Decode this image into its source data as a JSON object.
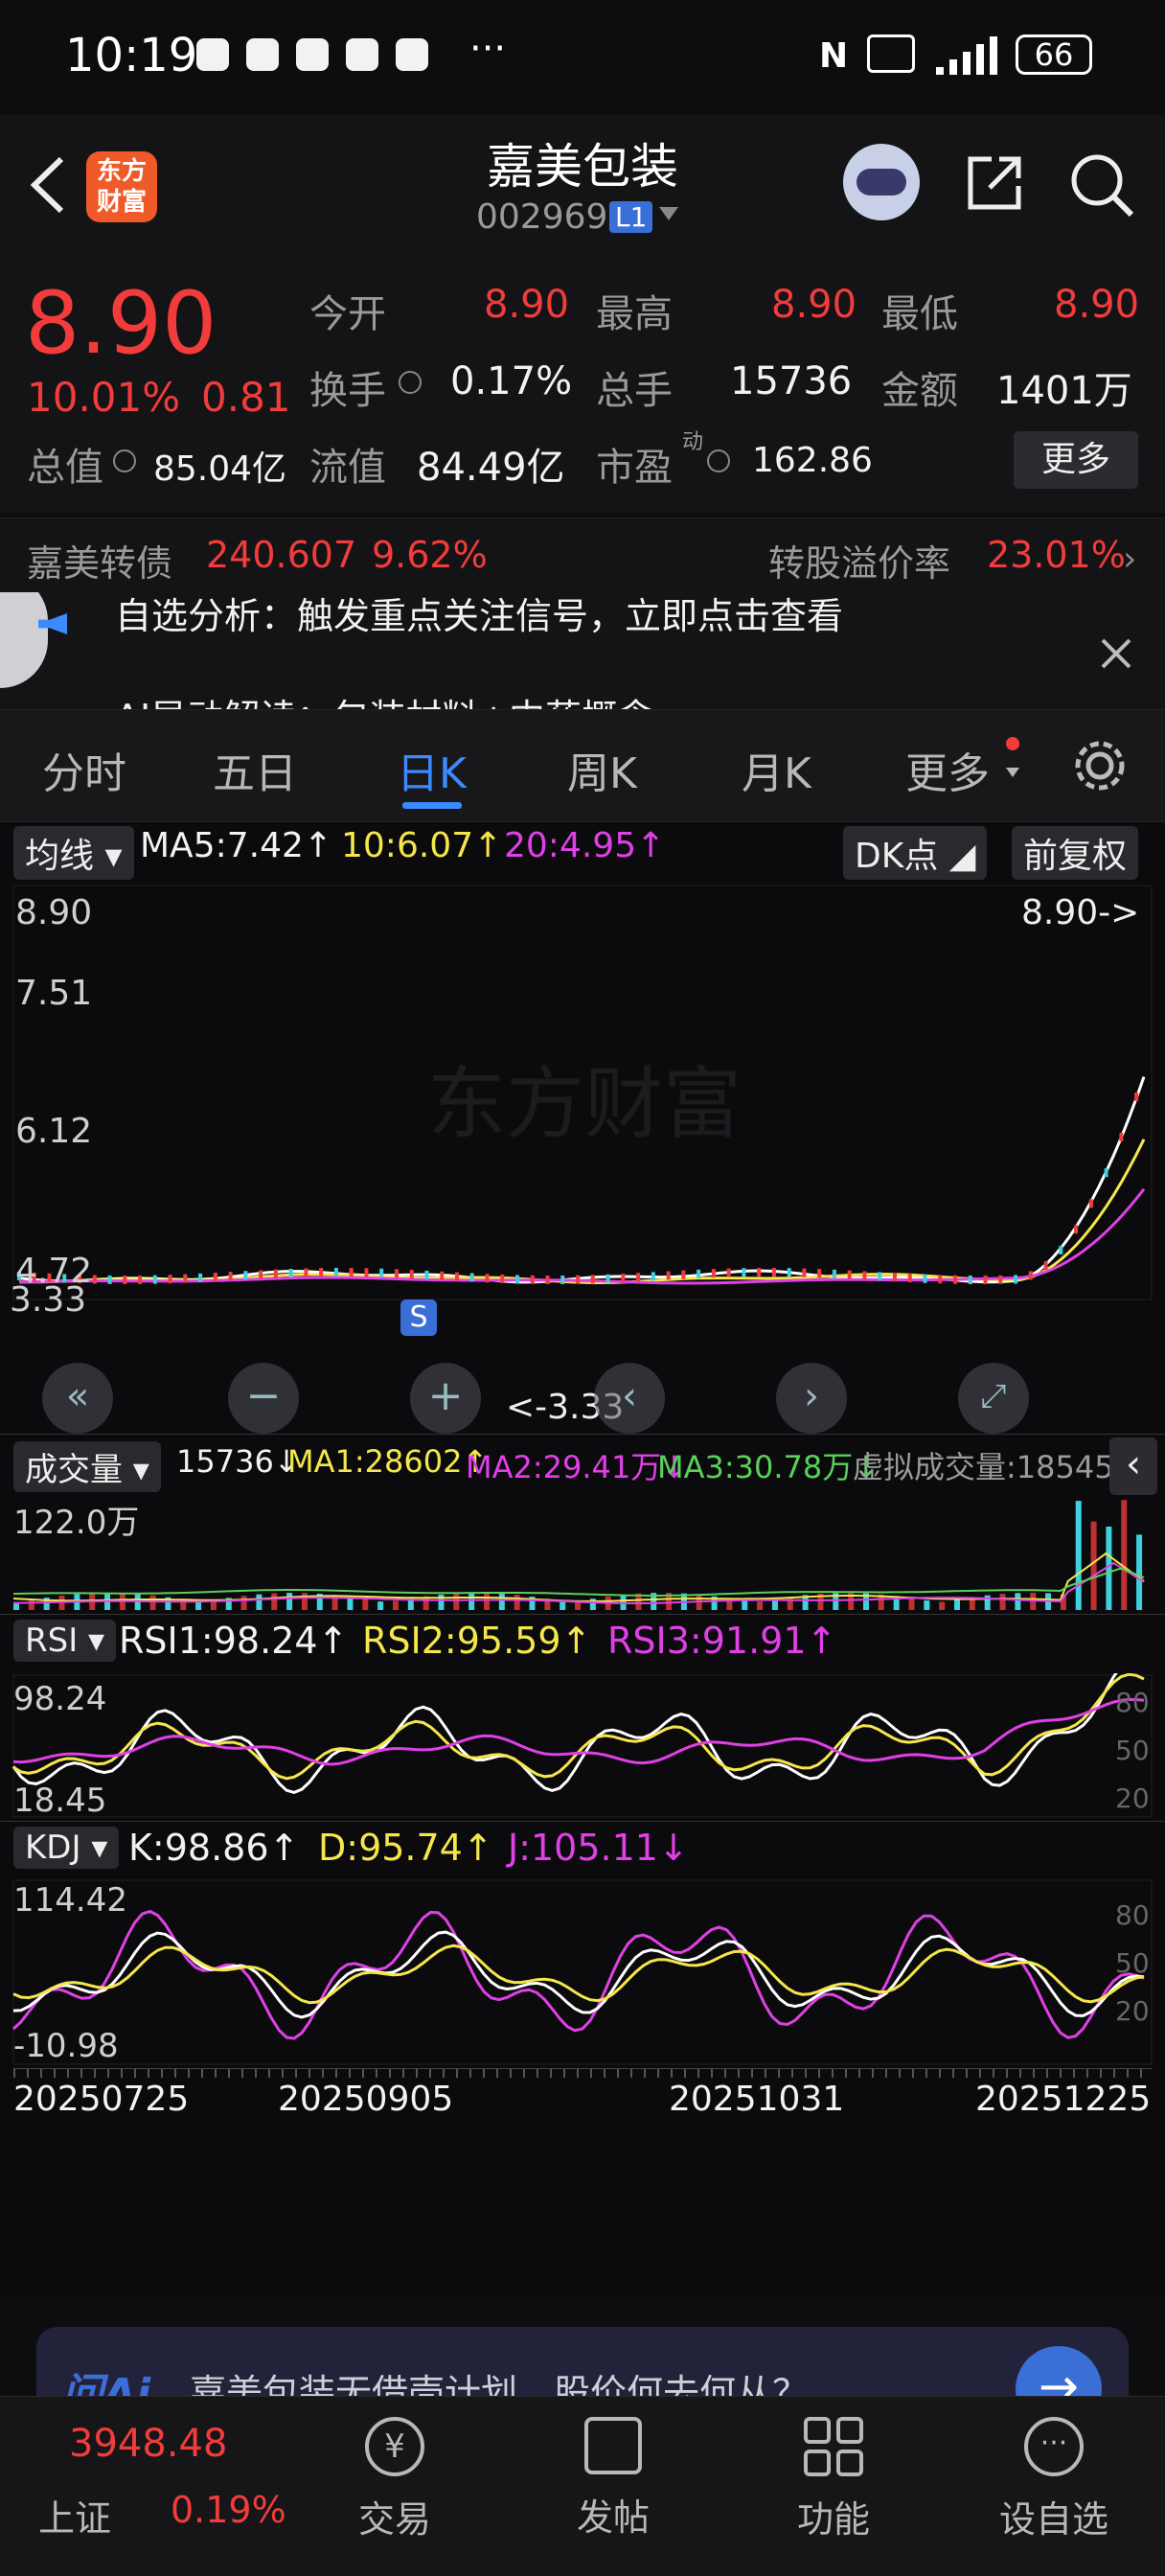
{
  "status": {
    "time": "10:19",
    "dots": "···",
    "battery": "66"
  },
  "header": {
    "stock_name": "嘉美包装",
    "stock_code": "002969",
    "level": "L1",
    "logo_text1": "东方",
    "logo_text2": "财富"
  },
  "quote": {
    "price": "8.90",
    "change_pct": "10.01%",
    "change": "0.81",
    "open_label": "今开",
    "open": "8.90",
    "high_label": "最高",
    "high": "8.90",
    "low_label": "最低",
    "low": "8.90",
    "turnover_label": "换手",
    "turnover": "0.17%",
    "volume_label": "总手",
    "volume": "15736",
    "amount_label": "金额",
    "amount": "1401万",
    "mktcap_label": "总值",
    "mktcap": "85.04亿",
    "float_label": "流值",
    "float_cap": "84.49亿",
    "pe_label": "市盈",
    "pe_sup": "动",
    "pe": "162.86",
    "more": "更多"
  },
  "bond": {
    "name": "嘉美转债",
    "price": "240.607",
    "pct": "9.62%",
    "premium_label": "转股溢价率",
    "premium": "23.01%"
  },
  "banner": {
    "line1": "自选分析：触发重点关注信号，立即点击查看",
    "line2": "AI异动解读：包装材料+中药概念"
  },
  "tabs": [
    "分时",
    "五日",
    "日K",
    "周K",
    "月K",
    "更多"
  ],
  "main_chart": {
    "indicator": "均线",
    "ma5": "MA5:7.42↑",
    "ma10": "10:6.07↑",
    "ma20": "20:4.95↑",
    "dk": "DK点",
    "adjust": "前复权",
    "y_top": "8.90",
    "y2": "7.51",
    "y3": "6.12",
    "y4": "4.72",
    "y_bottom": "3.33",
    "last_price_tag": "8.90->",
    "low_tag": "<-3.33",
    "s_marker": "S",
    "watermark": "东方财富"
  },
  "volume": {
    "label": "成交量",
    "v": "15736↓",
    "ma1": "MA1:28602↑",
    "ma2": "MA2:29.41万↓",
    "ma3": "MA3:30.78万↓",
    "virtual": "虚拟成交量:18545",
    "y_top": "122.0万"
  },
  "rsi": {
    "label": "RSI",
    "rsi1": "RSI1:98.24↑",
    "rsi2": "RSI2:95.59↑",
    "rsi3": "RSI3:91.91↑",
    "y_top": "98.24",
    "y_bottom": "18.45",
    "lvl80": "80",
    "lvl50": "50",
    "lvl20": "20"
  },
  "kdj": {
    "label": "KDJ",
    "k": "K:98.86↑",
    "d": "D:95.74↑",
    "j": "J:105.11↓",
    "y_top": "114.42",
    "y_bottom": "-10.98",
    "lvl80": "80",
    "lvl50": "50",
    "lvl20": "20"
  },
  "dates": [
    "20250725",
    "20250905",
    "20251031",
    "20251225"
  ],
  "ai_bar": {
    "brand": "问Ai",
    "text": "嘉美包装无借壳计划，股价何去何从？"
  },
  "index": {
    "value": "3948.48",
    "name": "上证",
    "pct": "0.19%"
  },
  "bottom_nav": [
    "交易",
    "发帖",
    "功能",
    "设自选"
  ],
  "colors": {
    "up": "#f23c3c",
    "down": "#3fd0e0",
    "accent": "#3b8bff"
  }
}
